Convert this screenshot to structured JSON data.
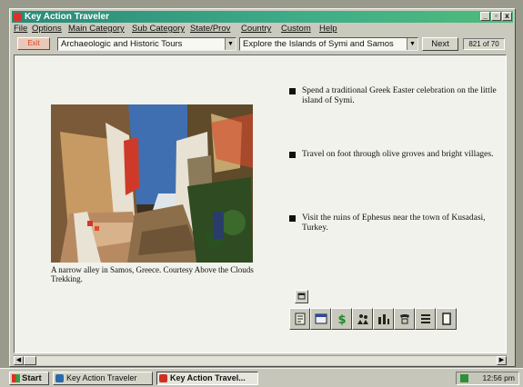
{
  "window": {
    "title": "Key Action Traveler",
    "min_glyph": "_",
    "max_glyph": "▫",
    "close_glyph": "x"
  },
  "menu": [
    "File",
    "Options",
    "Main Category",
    "Sub Category",
    "State/Prov",
    "Country",
    "Custom",
    "Help"
  ],
  "toolbar": {
    "exit_label": "Exit",
    "category_value": "Archaeologic and Historic Tours",
    "tour_value": "Explore the Islands of Symi and Samos",
    "next_label": "Next",
    "counter": "821 of 70"
  },
  "main": {
    "photo_caption": "A narrow alley in Samos, Greece. Courtesy Above the Clouds Trekking.",
    "bullets": [
      "Spend a traditional Greek Easter celebration on the little island of Symi.",
      "Travel on foot through olive groves and bright villages.",
      "Visit the ruins of Ephesus near the town of Kusadasi, Turkey."
    ]
  },
  "icon_bar": [
    "document-icon",
    "window-icon",
    "dollar-icon",
    "map-icon",
    "people-icon",
    "phone-icon",
    "list-icon",
    "notepad-icon"
  ],
  "taskbar": {
    "start_label": "Start",
    "tasks": [
      "Key Action Traveler",
      "Key Action Travel..."
    ],
    "clock": "12:56 pm"
  },
  "colors": {
    "titlebar": "#3fae88",
    "content_bg": "#f1f2ec",
    "chrome": "#c9c9bd"
  }
}
